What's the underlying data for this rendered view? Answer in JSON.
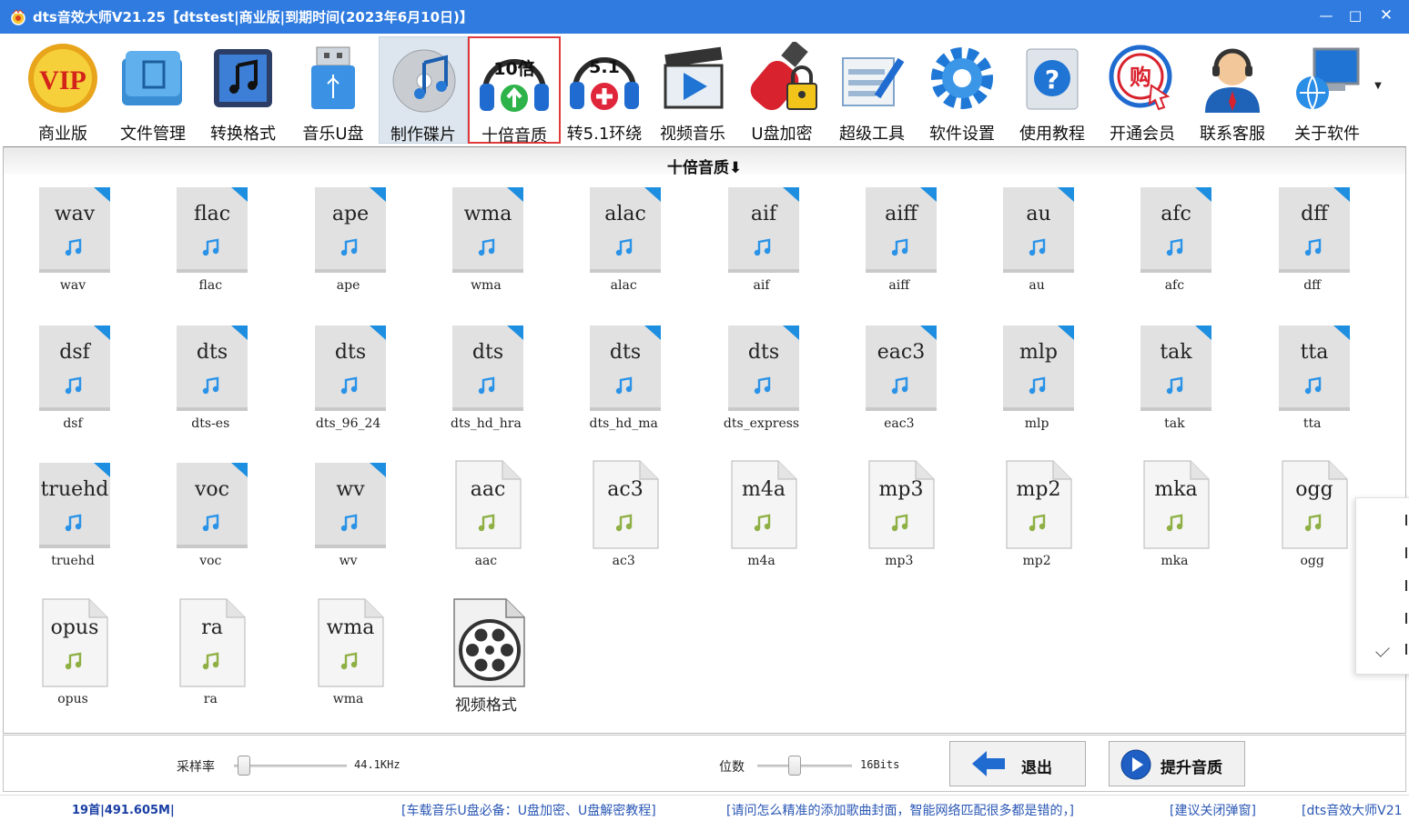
{
  "window": {
    "title": "dts音效大师V21.25【dtstest|商业版|到期时间(2023年6月10日)】",
    "min_glyph": "—",
    "max_glyph": "□",
    "close_glyph": "✕"
  },
  "toolbar": {
    "items": [
      {
        "label": "商业版",
        "icon": "vip-badge-icon"
      },
      {
        "label": "文件管理",
        "icon": "folder-icon"
      },
      {
        "label": "转换格式",
        "icon": "music-note-icon"
      },
      {
        "label": "音乐U盘",
        "icon": "usb-drive-icon"
      },
      {
        "label": "制作碟片",
        "icon": "music-disc-icon",
        "state": "active"
      },
      {
        "label": "十倍音质",
        "icon": "headphones-upgrade-icon",
        "badge": "10倍",
        "state": "highlighted"
      },
      {
        "label": "转5.1环绕",
        "icon": "headphones-surround-icon",
        "badge": "5.1"
      },
      {
        "label": "视频音乐",
        "icon": "video-play-icon"
      },
      {
        "label": "U盘加密",
        "icon": "usb-lock-icon"
      },
      {
        "label": "超级工具",
        "icon": "tools-icon"
      },
      {
        "label": "软件设置",
        "icon": "gear-icon"
      },
      {
        "label": "使用教程",
        "icon": "help-book-icon"
      },
      {
        "label": "开通会员",
        "icon": "shopping-icon",
        "badge": "购"
      },
      {
        "label": "联系客服",
        "icon": "customer-service-icon"
      },
      {
        "label": "关于软件",
        "icon": "computer-globe-icon"
      }
    ],
    "more_glyph": "▼"
  },
  "content": {
    "title": "十倍音质⬇",
    "formats": [
      {
        "ext": "wav",
        "label": "wav",
        "style": "blue"
      },
      {
        "ext": "flac",
        "label": "flac",
        "style": "blue"
      },
      {
        "ext": "ape",
        "label": "ape",
        "style": "blue"
      },
      {
        "ext": "wma",
        "label": "wma",
        "style": "blue"
      },
      {
        "ext": "alac",
        "label": "alac",
        "style": "blue"
      },
      {
        "ext": "aif",
        "label": "aif",
        "style": "blue"
      },
      {
        "ext": "aiff",
        "label": "aiff",
        "style": "blue"
      },
      {
        "ext": "au",
        "label": "au",
        "style": "blue"
      },
      {
        "ext": "afc",
        "label": "afc",
        "style": "blue"
      },
      {
        "ext": "dff",
        "label": "dff",
        "style": "blue"
      },
      {
        "ext": "dsf",
        "label": "dsf",
        "style": "blue"
      },
      {
        "ext": "dts",
        "label": "dts-es",
        "style": "blue"
      },
      {
        "ext": "dts",
        "label": "dts_96_24",
        "style": "blue"
      },
      {
        "ext": "dts",
        "label": "dts_hd_hra",
        "style": "blue"
      },
      {
        "ext": "dts",
        "label": "dts_hd_ma",
        "style": "blue"
      },
      {
        "ext": "dts",
        "label": "dts_express",
        "style": "blue"
      },
      {
        "ext": "eac3",
        "label": "eac3",
        "style": "blue"
      },
      {
        "ext": "mlp",
        "label": "mlp",
        "style": "blue"
      },
      {
        "ext": "tak",
        "label": "tak",
        "style": "blue"
      },
      {
        "ext": "tta",
        "label": "tta",
        "style": "blue"
      },
      {
        "ext": "truehd",
        "label": "truehd",
        "style": "blue"
      },
      {
        "ext": "voc",
        "label": "voc",
        "style": "blue"
      },
      {
        "ext": "wv",
        "label": "wv",
        "style": "blue"
      },
      {
        "ext": "aac",
        "label": "aac",
        "style": "green"
      },
      {
        "ext": "ac3",
        "label": "ac3",
        "style": "green"
      },
      {
        "ext": "m4a",
        "label": "m4a",
        "style": "green"
      },
      {
        "ext": "mp3",
        "label": "mp3",
        "style": "green"
      },
      {
        "ext": "mp2",
        "label": "mp2",
        "style": "green"
      },
      {
        "ext": "mka",
        "label": "mka",
        "style": "green"
      },
      {
        "ext": "ogg",
        "label": "ogg",
        "style": "green"
      },
      {
        "ext": "opus",
        "label": "opus",
        "style": "green"
      },
      {
        "ext": "ra",
        "label": "ra",
        "style": "green"
      },
      {
        "ext": "wma",
        "label": "wma",
        "style": "green"
      },
      {
        "ext": "",
        "label": "视频格式",
        "style": "video"
      }
    ]
  },
  "controls": {
    "sample_rate": {
      "label": "采样率",
      "value": "44.1KHz",
      "level": 0.04
    },
    "bit_depth": {
      "label": "位数",
      "value": "16Bits",
      "level": 0.38
    },
    "exit_label": "退出",
    "upgrade_label": "提升音质"
  },
  "statusbar": {
    "count": "19首|491.605M|",
    "links": [
      "[车载音乐U盘必备：U盘加密、U盘解密教程]",
      "[请问怎么精准的添加歌曲封面，智能网络匹配很多都是错的，]",
      "[建议关闭弹窗]",
      "[dts音效大师V21"
    ]
  },
  "colors": {
    "titlebar": "#2f7be0",
    "accent_blue": "#2196f3",
    "highlight_red": "#e03b3b",
    "link_blue": "#2a57b5"
  }
}
